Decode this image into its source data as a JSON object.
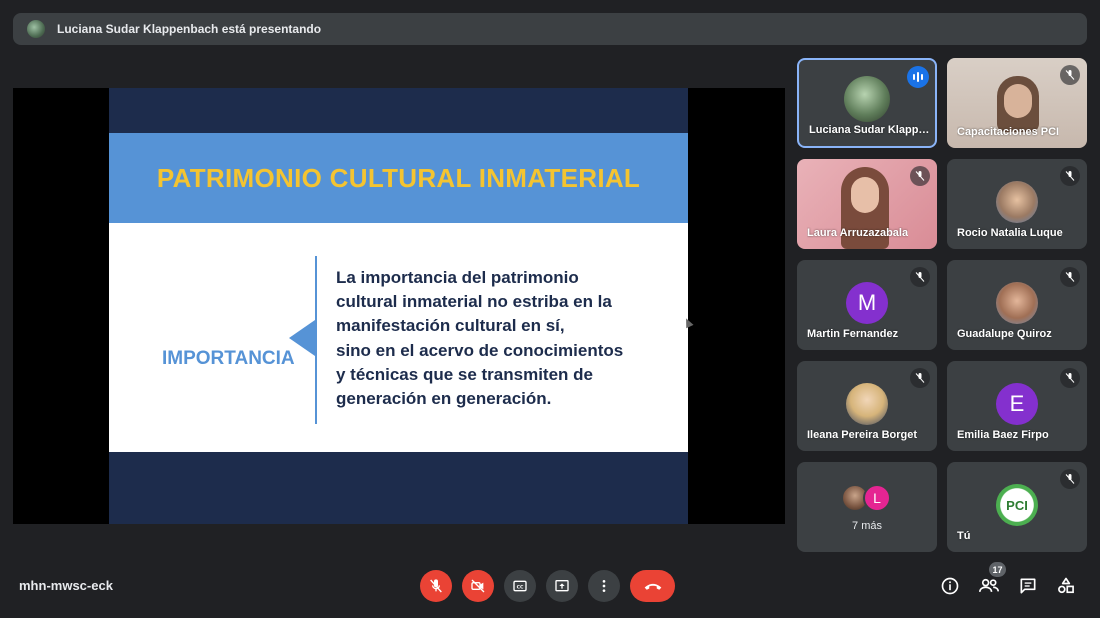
{
  "banner": {
    "text": "Luciana Sudar Klappenbach está presentando"
  },
  "slide": {
    "title": "PATRIMONIO CULTURAL INMATERIAL",
    "side_label": "IMPORTANCIA",
    "body_lines": [
      "La importancia del patrimonio",
      "cultural inmaterial no estriba en la",
      "manifestación cultural en sí,",
      "sino en el acervo de conocimientos",
      "y técnicas que se transmiten de",
      "generación en generación."
    ]
  },
  "participants": [
    {
      "name": "Luciana Sudar Klappenbach",
      "state": "speaking"
    },
    {
      "name": "Capacitaciones PCI",
      "state": "muted"
    },
    {
      "name": "Laura Arruzazabala",
      "state": "muted"
    },
    {
      "name": "Rocio Natalia Luque",
      "state": "muted"
    },
    {
      "name": "Martin Fernandez",
      "initial": "M",
      "color": "#8430ce",
      "state": "muted"
    },
    {
      "name": "Guadalupe Quiroz",
      "state": "muted"
    },
    {
      "name": "Ileana Pereira Borget",
      "state": "muted"
    },
    {
      "name": "Emilia Baez Firpo",
      "initial": "E",
      "color": "#8430ce",
      "state": "muted"
    },
    {
      "name": "Tú",
      "avatar_text": "PCI",
      "state": "muted"
    }
  ],
  "more": {
    "label": "7 más",
    "initial": "L"
  },
  "footer": {
    "meeting_code": "mhn-mwsc-eck",
    "participant_count": "17"
  },
  "colors": {
    "background": "#202124",
    "tile": "#3c4043",
    "danger": "#ea4335",
    "accent": "#1a73e8",
    "slide_navy": "#1d2c4c",
    "slide_blue": "#5693d6",
    "slide_gold": "#f4c431"
  },
  "icons": [
    "mic-off-icon",
    "camera-off-icon",
    "captions-icon",
    "present-icon",
    "more-vert-icon",
    "hangup-icon",
    "info-icon",
    "people-icon",
    "chat-icon",
    "activities-icon"
  ]
}
